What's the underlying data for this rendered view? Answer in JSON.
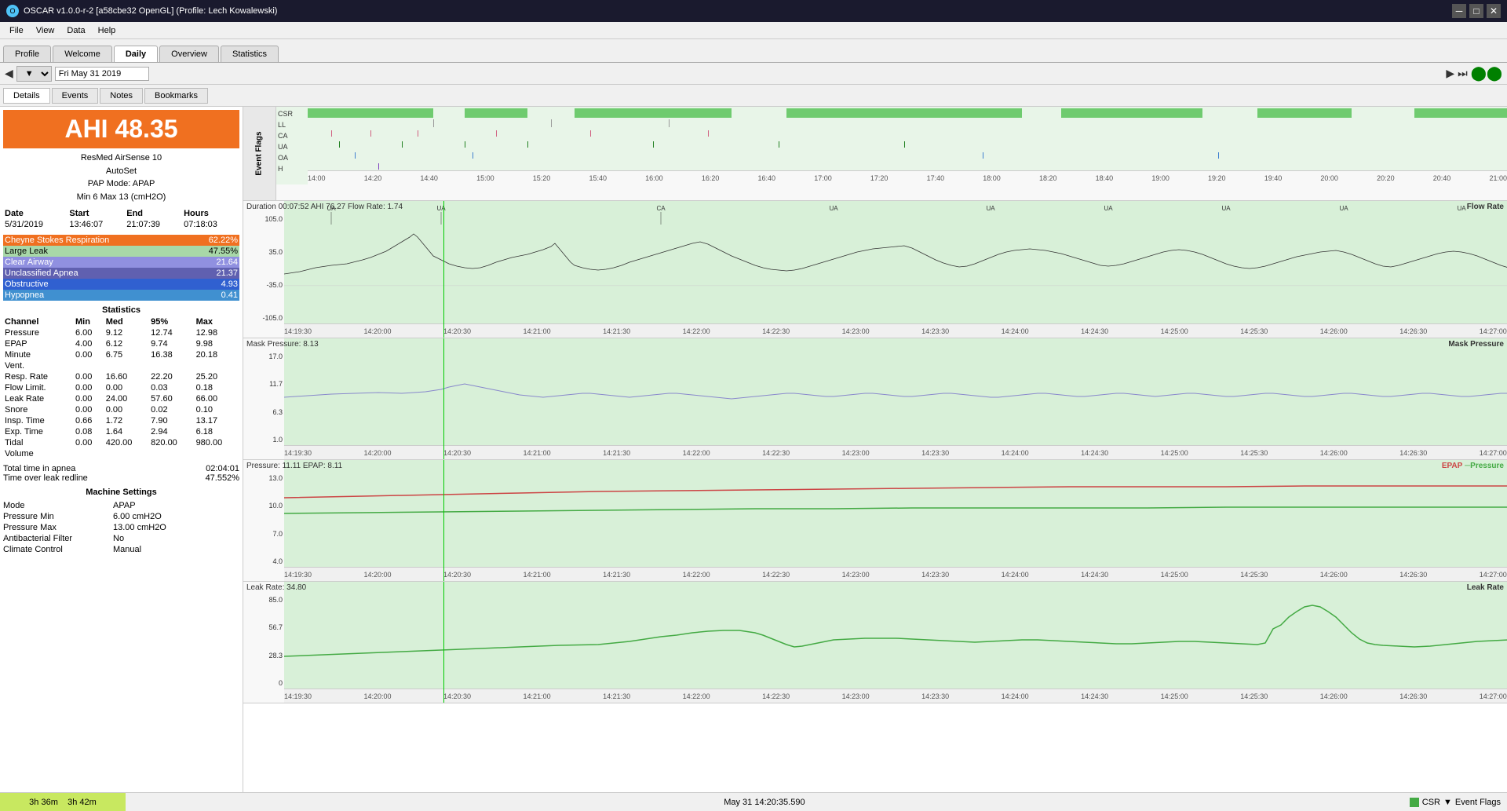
{
  "titleBar": {
    "title": "OSCAR v1.0.0-r-2 [a58cbe32 OpenGL] (Profile: Lech Kowalewski)",
    "icon": "O"
  },
  "menuBar": {
    "items": [
      "File",
      "View",
      "Data",
      "Help"
    ]
  },
  "tabs": [
    {
      "label": "Profile",
      "active": false
    },
    {
      "label": "Welcome",
      "active": false
    },
    {
      "label": "Daily",
      "active": true
    },
    {
      "label": "Overview",
      "active": false
    },
    {
      "label": "Statistics",
      "active": false
    }
  ],
  "navBar": {
    "date": "Fri May 31 2019",
    "prevLabel": "◀",
    "nextLabel": "▶",
    "calendarIcon": "⬤⬤"
  },
  "subTabs": [
    {
      "label": "Details",
      "active": true
    },
    {
      "label": "Events",
      "active": false
    },
    {
      "label": "Notes",
      "active": false
    },
    {
      "label": "Bookmarks",
      "active": false
    }
  ],
  "leftPanel": {
    "ahi": {
      "label": "AHI",
      "value": "48.35"
    },
    "device": {
      "name": "ResMed AirSense 10",
      "mode": "AutoSet",
      "papMode": "PAP Mode: APAP",
      "pressure": "Min 6 Max 13 (cmH2O)"
    },
    "table": {
      "headers": [
        "Date",
        "Start",
        "End",
        "Hours"
      ],
      "row": [
        "5/31/2019",
        "13:46:07",
        "21:07:39",
        "07:18:03"
      ]
    },
    "events": [
      {
        "label": "Cheyne Stokes Respiration",
        "value": "62.22%",
        "class": "cheyne"
      },
      {
        "label": "Large Leak",
        "value": "47.55%",
        "class": "large-leak"
      },
      {
        "label": "Clear Airway",
        "value": "21.64",
        "class": "clear"
      },
      {
        "label": "Unclassified Apnea",
        "value": "21.37",
        "class": "unclassified"
      },
      {
        "label": "Obstructive",
        "value": "4.93",
        "class": "obstructive"
      },
      {
        "label": "Hypopnea",
        "value": "0.41",
        "class": "hypopnea"
      }
    ],
    "statistics": {
      "title": "Statistics",
      "headers": [
        "Channel",
        "Min",
        "Med",
        "95%",
        "Max"
      ],
      "rows": [
        [
          "Pressure",
          "6.00",
          "9.12",
          "12.74",
          "12.98"
        ],
        [
          "EPAP",
          "4.00",
          "6.12",
          "9.74",
          "9.98"
        ],
        [
          "Minute",
          "0.00",
          "6.75",
          "16.38",
          "20.18"
        ],
        [
          "Vent.",
          "",
          "",
          "",
          ""
        ],
        [
          "Resp. Rate",
          "0.00",
          "16.60",
          "22.20",
          "25.20"
        ],
        [
          "Flow Limit.",
          "0.00",
          "0.00",
          "0.03",
          "0.18"
        ],
        [
          "Leak Rate",
          "0.00",
          "24.00",
          "57.60",
          "66.00"
        ],
        [
          "Snore",
          "0.00",
          "0.00",
          "0.02",
          "0.10"
        ],
        [
          "Insp. Time",
          "0.66",
          "1.72",
          "7.90",
          "13.17"
        ],
        [
          "Exp. Time",
          "0.08",
          "1.64",
          "2.94",
          "6.18"
        ],
        [
          "Tidal",
          "0.00",
          "420.00",
          "820.00",
          "980.00"
        ],
        [
          "Volume",
          "",
          "",
          "",
          ""
        ]
      ]
    },
    "totals": {
      "apnea": "Total time in apnea",
      "apneaValue": "02:04:01",
      "leak": "Time over leak redline",
      "leakValue": "47.552%"
    },
    "machineSettings": {
      "title": "Machine Settings",
      "settings": [
        {
          "label": "Mode",
          "value": "APAP"
        },
        {
          "label": "Pressure Min",
          "value": "6.00 cmH2O"
        },
        {
          "label": "Pressure Max",
          "value": "13.00 cmH2O"
        },
        {
          "label": "Antibacterial Filter",
          "value": "No"
        },
        {
          "label": "Climate Control",
          "value": "Manual"
        }
      ]
    }
  },
  "charts": {
    "eventFlags": {
      "title": "Event Flags",
      "labels": [
        "CSR",
        "LL",
        "CA",
        "UA",
        "OA",
        "H"
      ],
      "timeRange": "14:00 - 21:00"
    },
    "flowRate": {
      "title": "Duration 00:07:52 AHI 76.27 Flow Rate: 1.74",
      "legendLabel": "Flow Rate",
      "yMax": "105.0",
      "yMid": "35.0",
      "yLow": "-35.0",
      "yMin": "-105.0",
      "timeLabels": [
        "14:19:30",
        "14:20:00",
        "14:20:30",
        "14:21:00",
        "14:21:30",
        "14:22:00",
        "14:22:30",
        "14:23:00",
        "14:23:30",
        "14:24:00",
        "14:24:30",
        "14:25:00",
        "14:25:30",
        "14:26:00",
        "14:26:30",
        "14:27:00"
      ],
      "annotations": [
        "UA",
        "UA",
        "CA",
        "UA",
        "UA",
        "UA",
        "UA",
        "UA",
        "UA"
      ]
    },
    "maskPressure": {
      "title": "Mask Pressure: 8.13",
      "legendLabel": "Mask Pressure",
      "yMax": "17.0",
      "yMid": "11.7",
      "yLow": "6.3",
      "yMin": "1.0",
      "timeLabels": [
        "14:19:30",
        "14:20:00",
        "14:20:30",
        "14:21:00",
        "14:21:30",
        "14:22:00",
        "14:22:30",
        "14:23:00",
        "14:23:30",
        "14:24:00",
        "14:24:30",
        "14:25:00",
        "14:25:30",
        "14:26:00",
        "14:26:30",
        "14:27:00"
      ]
    },
    "pressure": {
      "title": "Pressure: 11.11 EPAP: 8.11",
      "legendLabel": "EPAP-Pressure",
      "yMax": "13.0",
      "yMid1": "10.0",
      "yMid2": "7.0",
      "yMin": "4.0",
      "timeLabels": [
        "14:19:30",
        "14:20:00",
        "14:20:30",
        "14:21:00",
        "14:21:30",
        "14:22:00",
        "14:22:30",
        "14:23:00",
        "14:23:30",
        "14:24:00",
        "14:24:30",
        "14:25:00",
        "14:25:30",
        "14:26:00",
        "14:26:30",
        "14:27:00"
      ]
    },
    "leakRate": {
      "title": "Leak Rate: 34.80",
      "legendLabel": "Leak Rate",
      "yMax": "85.0",
      "yMid1": "56.7",
      "yMid2": "28.3",
      "yMin": "0",
      "timeLabels": [
        "14:19:30",
        "14:20:00",
        "14:20:30",
        "14:21:00",
        "14:21:30",
        "14:22:00",
        "14:22:30",
        "14:23:00",
        "14:23:30",
        "14:24:00",
        "14:24:30",
        "14:25:00",
        "14:25:30",
        "14:26:00",
        "14:26:30",
        "14:27:00"
      ]
    }
  },
  "bottomStatus": {
    "leftTime": "3h 36m",
    "rightTime": "3h 42m",
    "date": "May 31 14:20:35.590",
    "csr": "CSR",
    "eventFlags": "Event Flags"
  }
}
